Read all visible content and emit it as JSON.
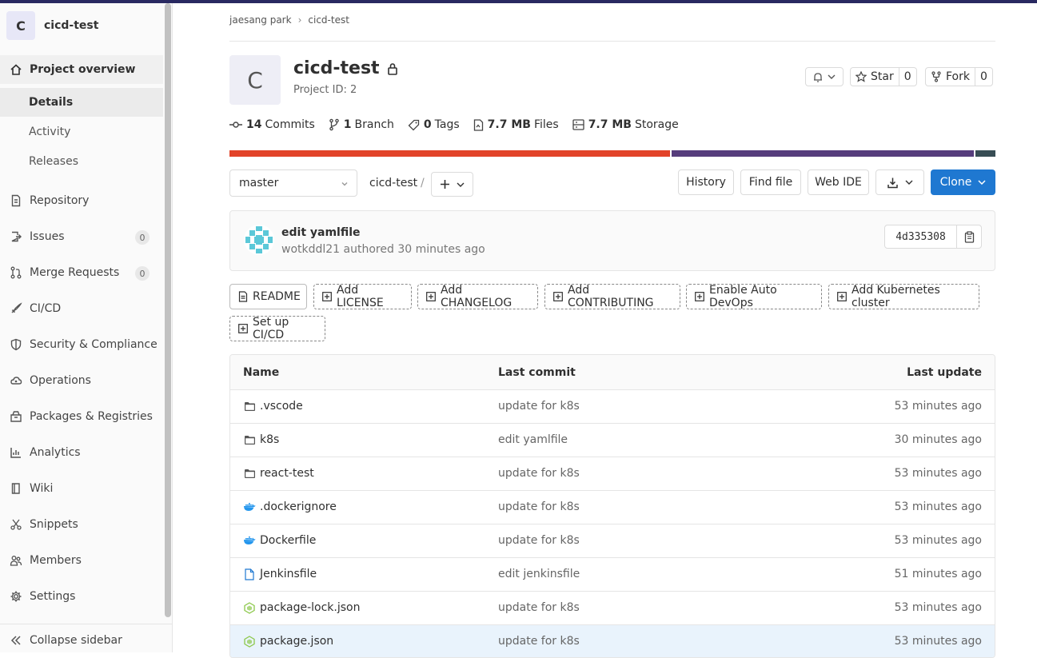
{
  "sidebar": {
    "project_initial": "C",
    "project_name": "cicd-test",
    "items": [
      {
        "label": "Project overview",
        "icon": "home-icon"
      },
      {
        "label": "Details"
      },
      {
        "label": "Activity"
      },
      {
        "label": "Releases"
      },
      {
        "label": "Repository",
        "icon": "doc-icon"
      },
      {
        "label": "Issues",
        "icon": "issues-icon",
        "badge": "0"
      },
      {
        "label": "Merge Requests",
        "icon": "merge-icon",
        "badge": "0"
      },
      {
        "label": "CI/CD",
        "icon": "rocket-icon"
      },
      {
        "label": "Security & Compliance",
        "icon": "shield-icon"
      },
      {
        "label": "Operations",
        "icon": "cloud-icon"
      },
      {
        "label": "Packages & Registries",
        "icon": "package-icon"
      },
      {
        "label": "Analytics",
        "icon": "chart-icon"
      },
      {
        "label": "Wiki",
        "icon": "book-icon"
      },
      {
        "label": "Snippets",
        "icon": "scissors-icon"
      },
      {
        "label": "Members",
        "icon": "users-icon"
      },
      {
        "label": "Settings",
        "icon": "gear-icon"
      }
    ],
    "collapse_label": "Collapse sidebar"
  },
  "breadcrumb": {
    "owner": "jaesang park",
    "sep": "›",
    "project": "cicd-test"
  },
  "project": {
    "initial": "C",
    "title": "cicd-test",
    "project_id": "Project ID: 2",
    "star_label": "Star",
    "star_count": "0",
    "fork_label": "Fork",
    "fork_count": "0"
  },
  "stats": {
    "commits_num": "14",
    "commits_label": "Commits",
    "branch_num": "1",
    "branch_label": "Branch",
    "tags_num": "0",
    "tags_label": "Tags",
    "files_num": "7.7 MB",
    "files_label": "Files",
    "storage_num": "7.7 MB",
    "storage_label": "Storage"
  },
  "language_bar": [
    {
      "color": "#e24329",
      "share": 57.5
    },
    {
      "color": "#563d7c",
      "share": 39.7
    },
    {
      "color": "#384d54",
      "share": 2.8
    }
  ],
  "toolbar": {
    "branch": "master",
    "path_root": "cicd-test",
    "path_sep": "/",
    "history": "History",
    "find_file": "Find file",
    "web_ide": "Web IDE",
    "clone": "Clone"
  },
  "last_commit": {
    "title": "edit yamlfile",
    "meta": "wotkddl21 authored 30 minutes ago",
    "sha": "4d335308"
  },
  "quick_actions": [
    "README",
    "Add LICENSE",
    "Add CHANGELOG",
    "Add CONTRIBUTING",
    "Enable Auto DevOps",
    "Add Kubernetes cluster",
    "Set up CI/CD"
  ],
  "files_table": {
    "headers": {
      "name": "Name",
      "last_commit": "Last commit",
      "last_update": "Last update"
    },
    "rows": [
      {
        "name": ".vscode",
        "icon": "folder-icon",
        "commit": "update for k8s",
        "updated": "53 minutes ago"
      },
      {
        "name": "k8s",
        "icon": "folder-icon",
        "commit": "edit yamlfile",
        "updated": "30 minutes ago"
      },
      {
        "name": "react-test",
        "icon": "folder-icon",
        "commit": "update for k8s",
        "updated": "53 minutes ago"
      },
      {
        "name": ".dockerignore",
        "icon": "docker-icon",
        "commit": "update for k8s",
        "updated": "53 minutes ago"
      },
      {
        "name": "Dockerfile",
        "icon": "docker-icon",
        "commit": "update for k8s",
        "updated": "53 minutes ago"
      },
      {
        "name": "Jenkinsfile",
        "icon": "file-icon",
        "commit": "edit jenkinsfile",
        "updated": "51 minutes ago"
      },
      {
        "name": "package-lock.json",
        "icon": "node-icon",
        "commit": "update for k8s",
        "updated": "53 minutes ago"
      },
      {
        "name": "package.json",
        "icon": "node-icon",
        "commit": "update for k8s",
        "updated": "53 minutes ago"
      }
    ]
  },
  "colors": {
    "accent": "#1f78d1",
    "topbar": "#292961"
  }
}
